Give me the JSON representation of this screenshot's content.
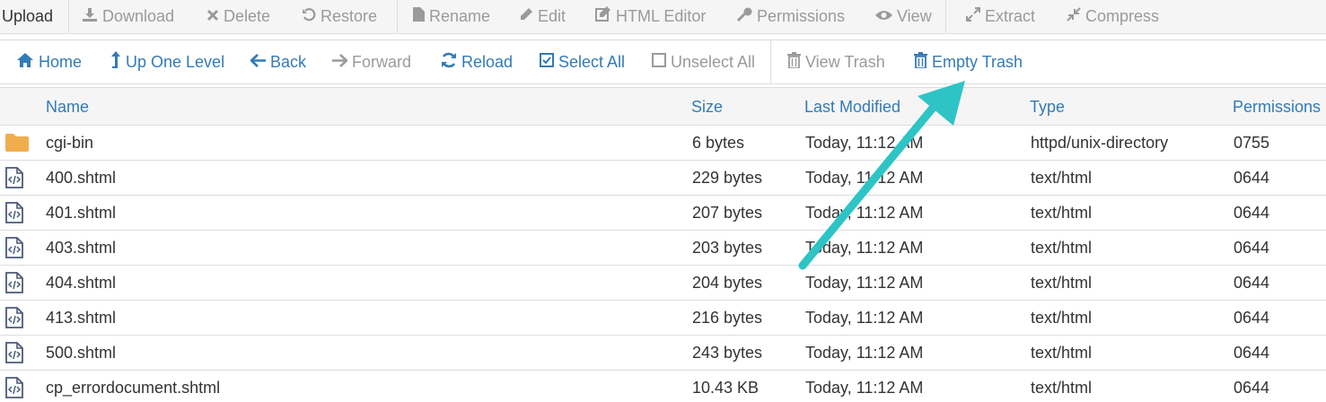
{
  "toolbar_top": {
    "upload": "Upload",
    "download": "Download",
    "delete": "Delete",
    "restore": "Restore",
    "rename": "Rename",
    "edit": "Edit",
    "html_editor": "HTML Editor",
    "permissions": "Permissions",
    "view": "View",
    "extract": "Extract",
    "compress": "Compress"
  },
  "toolbar_nav": {
    "home": "Home",
    "up_one_level": "Up One Level",
    "back": "Back",
    "forward": "Forward",
    "reload": "Reload",
    "select_all": "Select All",
    "unselect_all": "Unselect All",
    "view_trash": "View Trash",
    "empty_trash": "Empty Trash"
  },
  "table": {
    "headers": {
      "name": "Name",
      "size": "Size",
      "last_modified": "Last Modified",
      "type": "Type",
      "permissions": "Permissions"
    },
    "rows": [
      {
        "icon": "folder-icon",
        "name": "cgi-bin",
        "size": "6 bytes",
        "modified": "Today, 11:12 AM",
        "type": "httpd/unix-directory",
        "perm": "0755"
      },
      {
        "icon": "html-file-icon",
        "name": "400.shtml",
        "size": "229 bytes",
        "modified": "Today, 11:12 AM",
        "type": "text/html",
        "perm": "0644"
      },
      {
        "icon": "html-file-icon",
        "name": "401.shtml",
        "size": "207 bytes",
        "modified": "Today, 11:12 AM",
        "type": "text/html",
        "perm": "0644"
      },
      {
        "icon": "html-file-icon",
        "name": "403.shtml",
        "size": "203 bytes",
        "modified": "Today, 11:12 AM",
        "type": "text/html",
        "perm": "0644"
      },
      {
        "icon": "html-file-icon",
        "name": "404.shtml",
        "size": "204 bytes",
        "modified": "Today, 11:12 AM",
        "type": "text/html",
        "perm": "0644"
      },
      {
        "icon": "html-file-icon",
        "name": "413.shtml",
        "size": "216 bytes",
        "modified": "Today, 11:12 AM",
        "type": "text/html",
        "perm": "0644"
      },
      {
        "icon": "html-file-icon",
        "name": "500.shtml",
        "size": "243 bytes",
        "modified": "Today, 11:12 AM",
        "type": "text/html",
        "perm": "0644"
      },
      {
        "icon": "html-file-icon",
        "name": "cp_errordocument.shtml",
        "size": "10.43 KB",
        "modified": "Today, 11:12 AM",
        "type": "text/html",
        "perm": "0644"
      }
    ]
  },
  "colors": {
    "link": "#337ab7",
    "disabled": "#9a9a9a",
    "folder": "#f0ad4e",
    "arrow": "#2ec4c6"
  }
}
